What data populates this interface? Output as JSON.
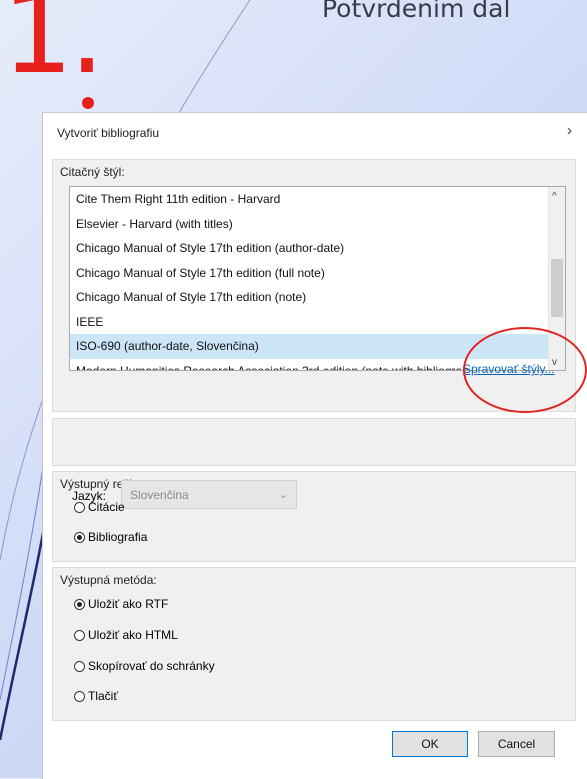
{
  "slide": {
    "number": "1.",
    "title": "Potvrdením dal"
  },
  "dialog": {
    "title": "Vytvoriť bibliografiu",
    "style_section": {
      "legend": "Citačný štýl:",
      "items": [
        "Cite Them Right 11th edition - Harvard",
        "Elsevier - Harvard (with titles)",
        "Chicago Manual of Style 17th edition (author-date)",
        "Chicago Manual of Style 17th edition (full note)",
        "Chicago Manual of Style 17th edition (note)",
        "IEEE",
        "ISO-690 (author-date, Slovenčina)",
        "Modern Humanities Research Association 3rd edition (note with bibliogran"
      ],
      "selected_item": "ISO-690 (author-date, Slovenčina)",
      "manage_link": "Spravovať štýly..."
    },
    "language": {
      "label": "Jazyk:",
      "value": "Slovenčina"
    },
    "output_mode": {
      "legend": "Výstupný režim:",
      "options": [
        "Citácie",
        "Bibliografia"
      ],
      "selected": "Bibliografia"
    },
    "output_method": {
      "legend": "Výstupná metóda:",
      "options": [
        "Uložiť ako RTF",
        "Uložiť ako HTML",
        "Skopírovať do schránky",
        "Tlačiť"
      ],
      "selected": "Uložiť ako RTF"
    },
    "buttons": {
      "ok": "OK",
      "cancel": "Cancel"
    }
  },
  "colors": {
    "accent_red": "#e8201c",
    "link_blue": "#0563c1",
    "selection": "#cde6f7"
  }
}
